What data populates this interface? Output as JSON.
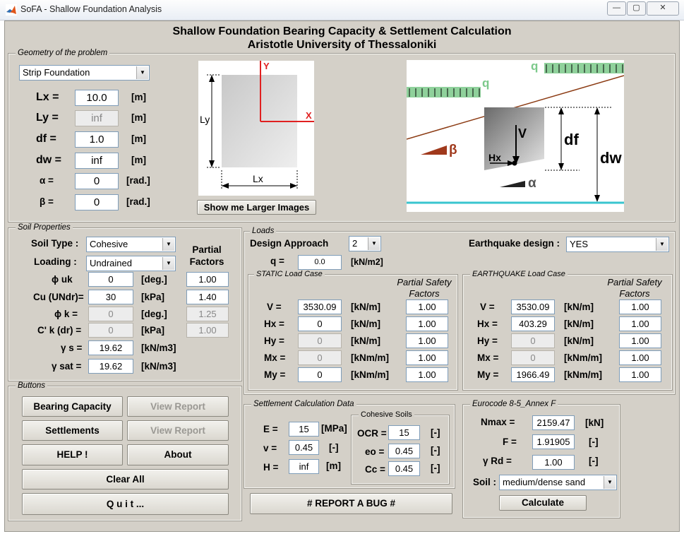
{
  "window": {
    "title": "SoFA - Shallow Foundation Analysis",
    "min": "▭",
    "max": "▢",
    "close": "✕"
  },
  "header": {
    "line1": "Shallow Foundation Bearing Capacity & Settlement Calculation",
    "line2": "Aristotle University of Thessaloniki"
  },
  "geometry": {
    "legend": "Geometry of the problem",
    "foundation_type": "Strip Foundation",
    "fields": [
      {
        "label": "Lx =",
        "value": "10.0",
        "unit": "[m]"
      },
      {
        "label": "Ly =",
        "value": "inf",
        "unit": "[m]"
      },
      {
        "label": "df =",
        "value": "1.0",
        "unit": "[m]"
      },
      {
        "label": "dw =",
        "value": "inf",
        "unit": "[m]"
      },
      {
        "label": "α =",
        "value": "0",
        "unit": "[rad.]"
      },
      {
        "label": "β =",
        "value": "0",
        "unit": "[rad.]"
      }
    ],
    "image1": {
      "y": "Y",
      "x": "X",
      "ly": "Ly",
      "lx": "Lx"
    },
    "larger_button": "Show me Larger Images",
    "image2": {
      "q1": "q",
      "q2": "q",
      "beta": "β",
      "v": "V",
      "hx": "Hx",
      "df": "df",
      "dw": "dw",
      "alpha": "α"
    }
  },
  "soil": {
    "legend": "Soil Properties",
    "soil_type_label": "Soil Type :",
    "soil_type": "Cohesive",
    "loading_label": "Loading :",
    "loading": "Undrained",
    "partial_header": "Partial Factors",
    "rows": [
      {
        "label": "ϕ uk",
        "value": "0",
        "unit": "[deg.]",
        "pf": "1.00"
      },
      {
        "label": "Cu (UNdr)=",
        "value": "30",
        "unit": "[kPa]",
        "pf": "1.40"
      },
      {
        "label": "ϕ k =",
        "value": "0",
        "unit": "[deg.]",
        "pf": "1.25"
      },
      {
        "label": "C' k (dr) =",
        "value": "0",
        "unit": "[kPa]",
        "pf": "1.00"
      },
      {
        "label": "γ s =",
        "value": "19.62",
        "unit": "[kN/m3]"
      },
      {
        "label": "γ sat =",
        "value": "19.62",
        "unit": "[kN/m3]"
      }
    ]
  },
  "loads": {
    "legend": "Loads",
    "design_approach_label": "Design Approach",
    "design_approach": "2",
    "earthquake_label": "Earthquake design :",
    "earthquake": "YES",
    "q_label": "q =",
    "q_value": "0.0",
    "q_unit": "[kN/m2]",
    "static": {
      "legend": "STATIC Load Case",
      "psf_header": "Partial Safety Factors",
      "rows": [
        {
          "label": "V =",
          "value": "3530.09",
          "unit": "[kN/m]",
          "f": "1.00"
        },
        {
          "label": "Hx =",
          "value": "0",
          "unit": "[kN/m]",
          "f": "1.00"
        },
        {
          "label": "Hy =",
          "value": "0",
          "unit": "[kN/m]",
          "f": "1.00"
        },
        {
          "label": "Mx =",
          "value": "0",
          "unit": "[kNm/m]",
          "f": "1.00"
        },
        {
          "label": "My =",
          "value": "0",
          "unit": "[kNm/m]",
          "f": "1.00"
        }
      ]
    },
    "quake": {
      "legend": "EARTHQUAKE Load Case",
      "psf_header": "Partial Safety Factors",
      "rows": [
        {
          "label": "V =",
          "value": "3530.09",
          "unit": "[kN/m]",
          "f": "1.00"
        },
        {
          "label": "Hx =",
          "value": "403.29",
          "unit": "[kN/m]",
          "f": "1.00"
        },
        {
          "label": "Hy =",
          "value": "0",
          "unit": "[kN/m]",
          "f": "1.00"
        },
        {
          "label": "Mx =",
          "value": "0",
          "unit": "[kNm/m]",
          "f": "1.00"
        },
        {
          "label": "My =",
          "value": "1966.49",
          "unit": "[kNm/m]",
          "f": "1.00"
        }
      ]
    }
  },
  "buttons": {
    "legend": "Buttons",
    "bearing": "Bearing Capacity",
    "view_report1": "View Report",
    "settlements": "Settlements",
    "view_report2": "View Report",
    "help": "HELP !",
    "about": "About",
    "clear": "Clear All",
    "quit": "Q u i t ..."
  },
  "settlement": {
    "legend": "Settlement Calculation Data",
    "e_label": "E =",
    "e": "15",
    "e_unit": "[MPa]",
    "v_label": "v =",
    "v": "0.45",
    "v_unit": "[-]",
    "h_label": "H =",
    "h": "inf",
    "h_unit": "[m]",
    "coh_legend": "Cohesive Soils",
    "ocr_label": "OCR =",
    "ocr": "15",
    "ocr_unit": "[-]",
    "eo_label": "eo =",
    "eo": "0.45",
    "eo_unit": "[-]",
    "cc_label": "Cc =",
    "cc": "0.45",
    "cc_unit": "[-]"
  },
  "report_bug": "# REPORT A BUG #",
  "eurocode": {
    "legend": "Eurocode 8-5_Annex F",
    "nmax_label": "Nmax =",
    "nmax": "2159.47",
    "nmax_unit": "[kN]",
    "f_label": "F =",
    "f": "1.91905",
    "f_unit": "[-]",
    "rd_label": "γ Rd =",
    "rd": "1.00",
    "rd_unit": "[-]",
    "soil_label": "Soil :",
    "soil": "medium/dense sand",
    "calc": "Calculate"
  }
}
